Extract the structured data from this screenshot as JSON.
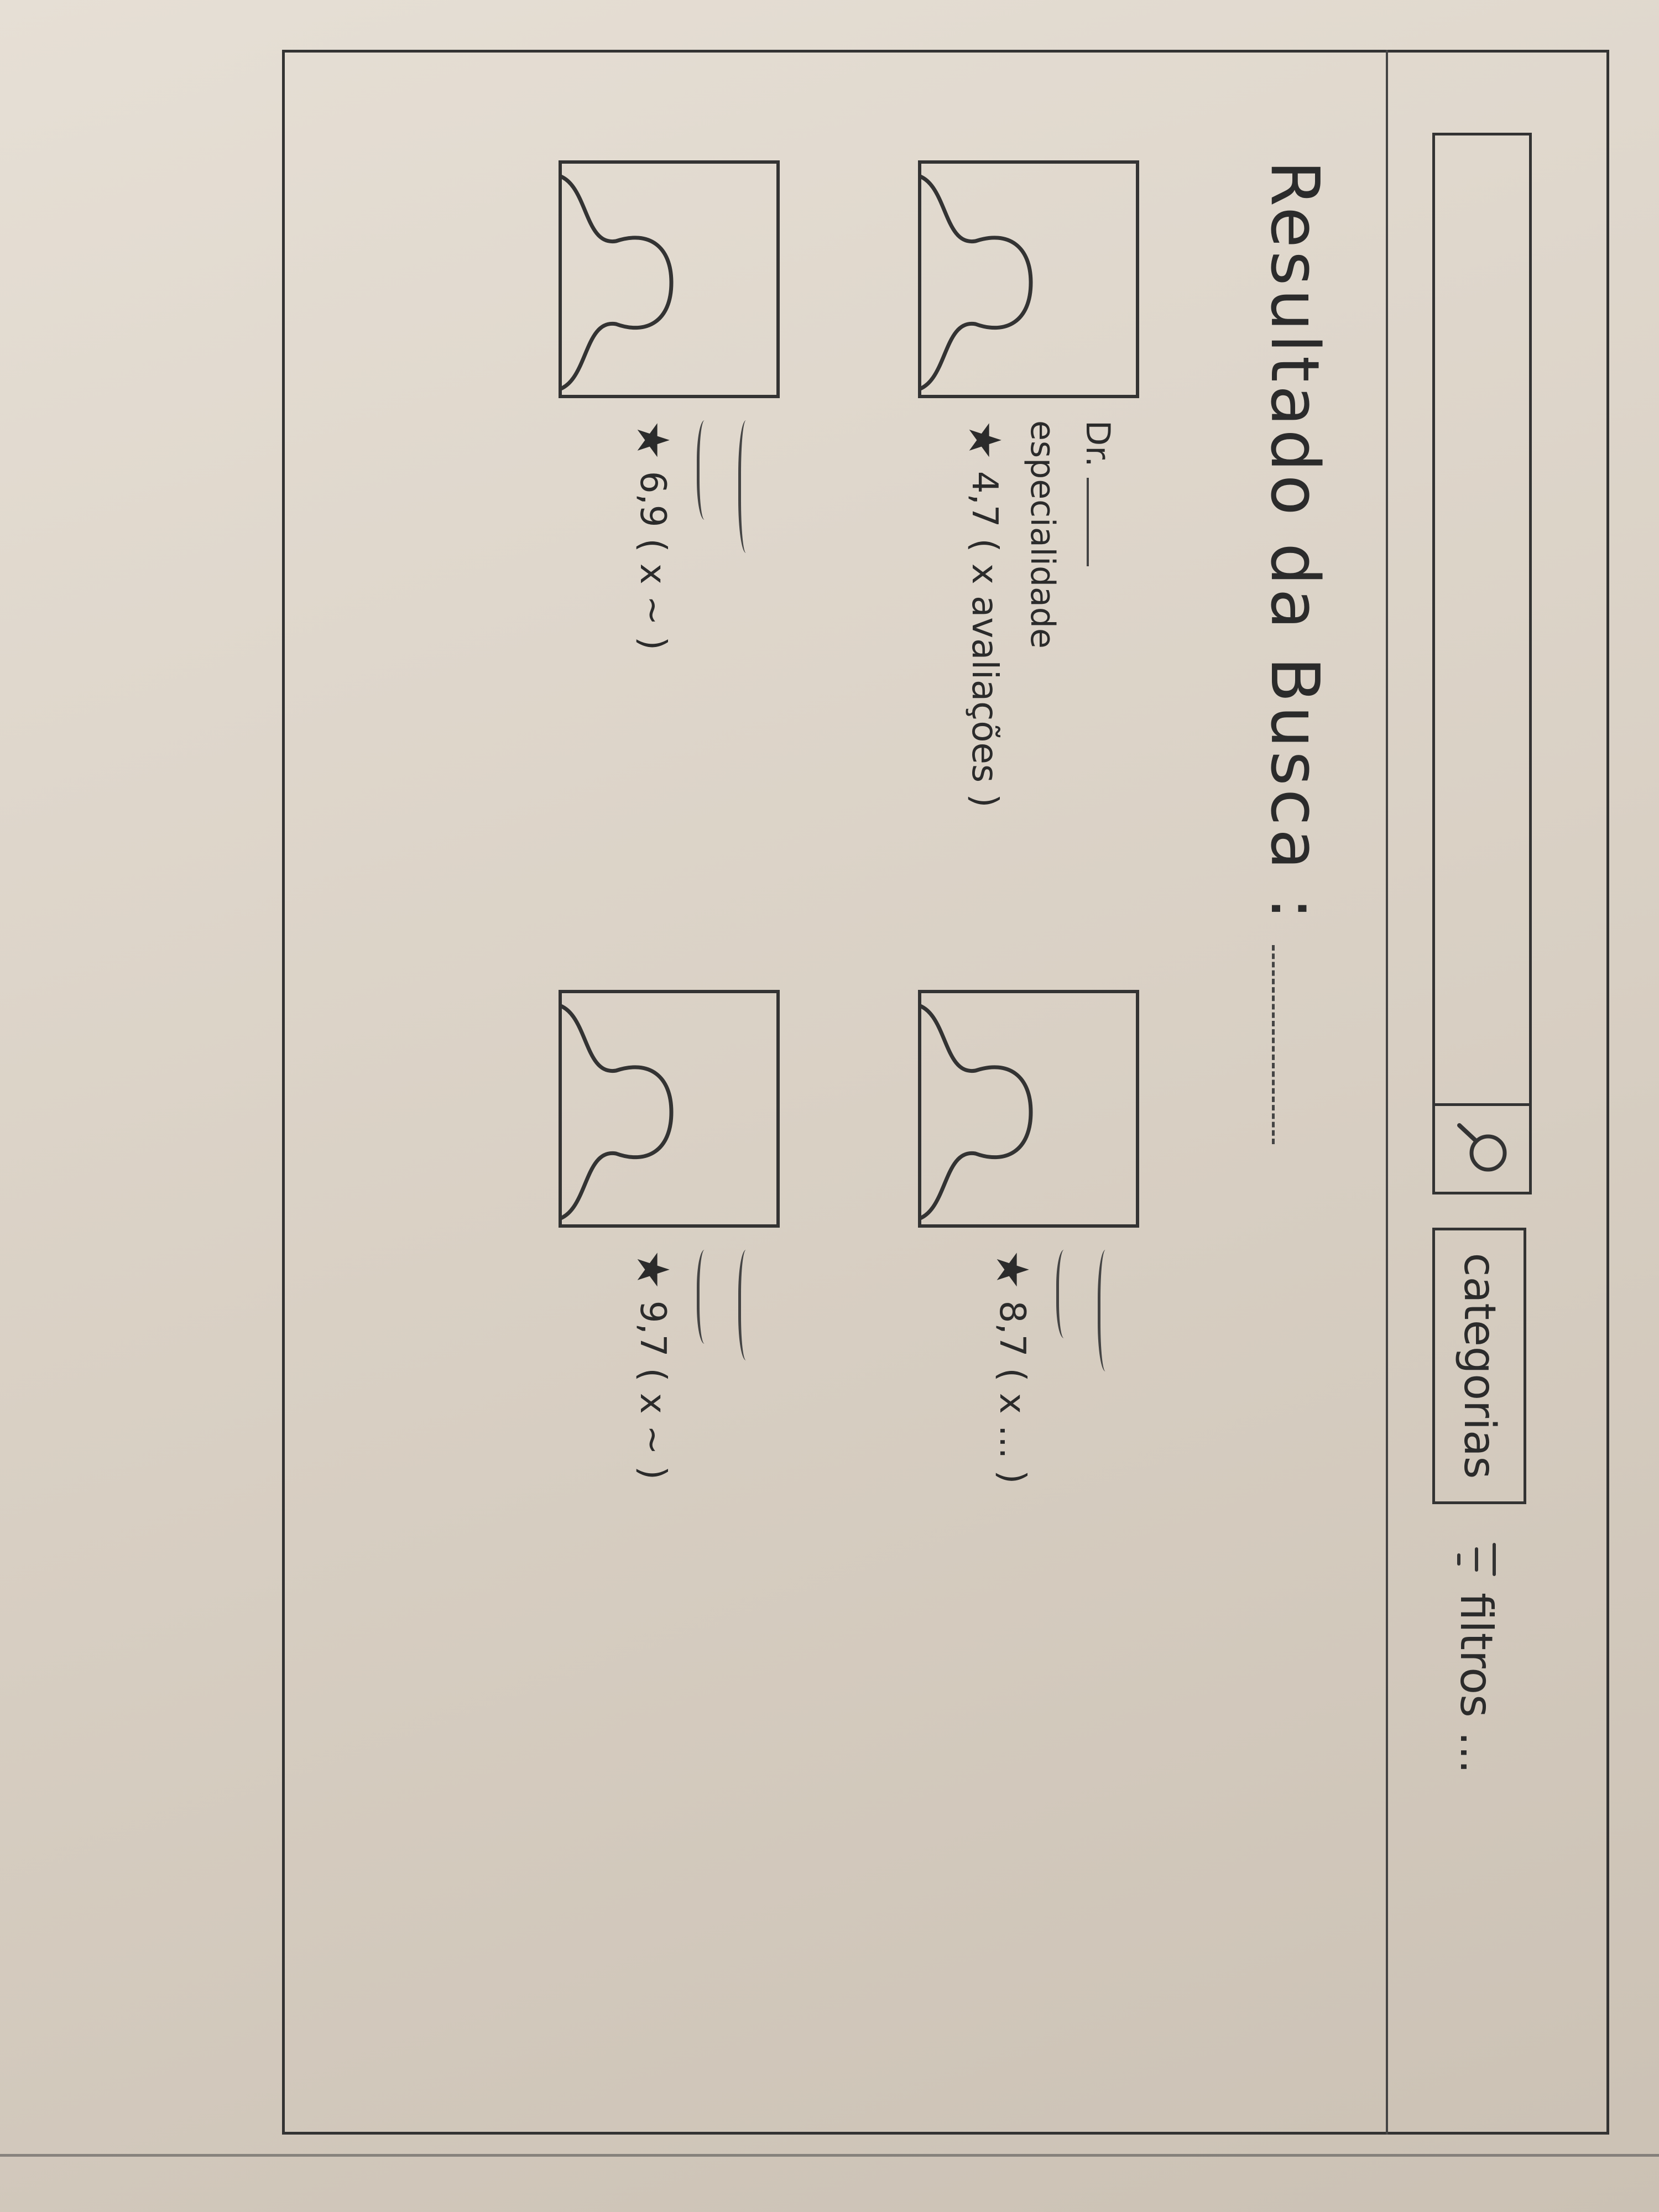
{
  "search": {
    "placeholder": ""
  },
  "toolbar": {
    "categories_label": "categorias",
    "filters_label": "filtros ..."
  },
  "results": {
    "title": "Resultado da Busca :"
  },
  "cards": [
    {
      "name": "Dr. ",
      "specialty": "especialidade",
      "rating": "4,7",
      "reviews": "( x avaliações )"
    },
    {
      "rating": "8,7",
      "reviews": "( x ... )"
    },
    {
      "rating": "6,9",
      "reviews": "( x ~ )"
    },
    {
      "rating": "9,7",
      "reviews": "( x ~ )"
    }
  ],
  "icons": {
    "search": "magnifier-icon",
    "filter": "filter-lines-icon",
    "star": "star-icon",
    "avatar": "person-silhouette-icon"
  }
}
